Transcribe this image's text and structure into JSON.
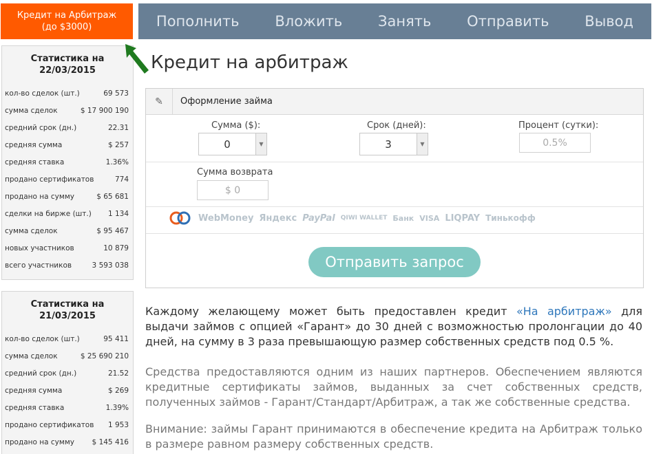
{
  "active_tab": {
    "line1": "Кредит на Арбитраж",
    "line2": "(до $3000)"
  },
  "nav": [
    "Пополнить",
    "Вложить",
    "Занять",
    "Отправить",
    "Вывод"
  ],
  "stats": [
    {
      "title": "Статистика на 22/03/2015",
      "rows": [
        {
          "label": "кол-во сделок (шт.)",
          "value": "69 573"
        },
        {
          "label": "сумма сделок",
          "value": "$ 17 900 190"
        },
        {
          "label": "средний срок (дн.)",
          "value": "22.31"
        },
        {
          "label": "средняя сумма",
          "value": "$ 257"
        },
        {
          "label": "средняя ставка",
          "value": "1.36%"
        },
        {
          "label": "продано сертификатов",
          "value": "774"
        },
        {
          "label": "продано на сумму",
          "value": "$ 65 681"
        },
        {
          "label": "сделки на бирже (шт.)",
          "value": "1 134"
        },
        {
          "label": "сумма сделок",
          "value": "$ 95 467"
        },
        {
          "label": "новых участников",
          "value": "10 879"
        },
        {
          "label": "всего участников",
          "value": "3 593 038"
        }
      ]
    },
    {
      "title": "Статистика на 21/03/2015",
      "rows": [
        {
          "label": "кол-во сделок (шт.)",
          "value": "95 411"
        },
        {
          "label": "сумма сделок",
          "value": "$ 25 690 210"
        },
        {
          "label": "средний срок (дн.)",
          "value": "21.52"
        },
        {
          "label": "средняя сумма",
          "value": "$ 269"
        },
        {
          "label": "средняя ставка",
          "value": "1.39%"
        },
        {
          "label": "продано сертификатов",
          "value": "1 953"
        },
        {
          "label": "продано на сумму",
          "value": "$ 145 416"
        }
      ]
    }
  ],
  "page_title": "Кредит на арбитраж",
  "form": {
    "header": "Оформление займа",
    "amount_label": "Сумма ($):",
    "amount_value": "0",
    "term_label": "Срок (дней):",
    "term_value": "3",
    "percent_label": "Процент (сутки):",
    "percent_value": "0.5%",
    "return_label": "Сумма возврата",
    "return_value": "$ 0",
    "payment_logos": [
      "WebMoney",
      "Яндекс",
      "PayPal",
      "QIWI WALLET",
      "Банк",
      "VISA",
      "LIQPAY",
      "Тинькофф"
    ],
    "submit": "Отправить запрос"
  },
  "text": {
    "p1_a": "Каждому желающему может быть предоставлен кредит ",
    "p1_link": "«На арбитраж»",
    "p1_b": " для выдачи займов с опцией «Гарант» до 30 дней с возможностью пролонгации до 40 дней, на сумму в 3 раза превышающую размер собственных средств под 0.5 %.",
    "p2": "Средства предоставляются одним из наших партнеров. Обеспечением являются кредитные сертификаты займов, выданных за счет собственных средств, полученных займов - Гарант/Стандарт/Арбитраж, а так же собственные средства.",
    "p3": "Внимание: займы Гарант принимаются в обеспечение кредита на Арбитраж только в размере равном размеру собственных средств."
  },
  "colors": {
    "accent": "#ff5a00",
    "nav_bg": "#687f95",
    "button": "#81c9c3",
    "link": "#2e77bb",
    "arrow": "#1f7a1f"
  }
}
